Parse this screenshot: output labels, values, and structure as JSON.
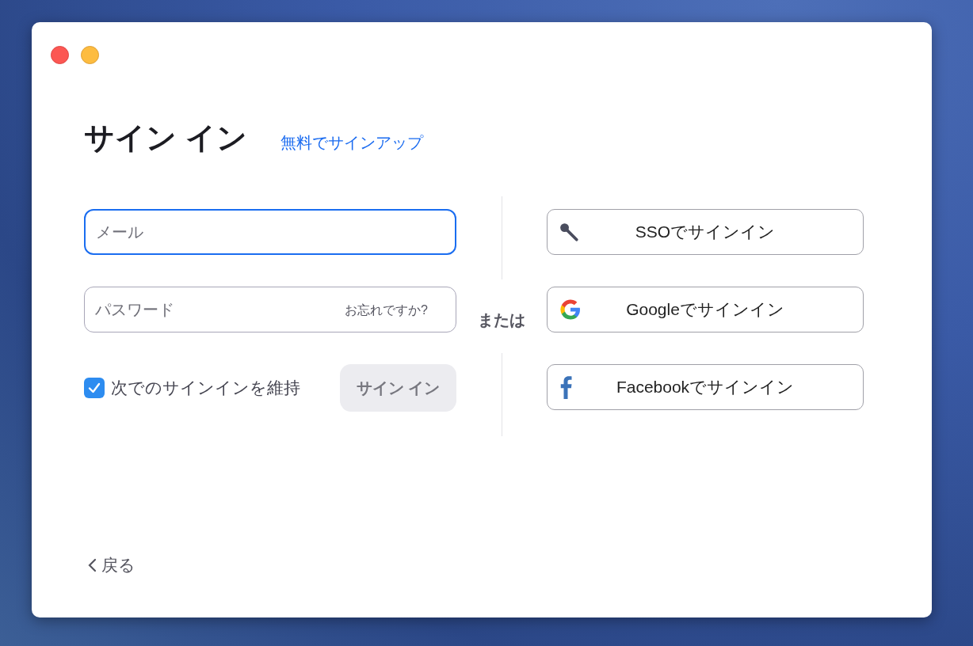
{
  "title": "サイン イン",
  "signup_link": "無料でサインアップ",
  "email_field": {
    "placeholder": "メール",
    "focused": true
  },
  "password_field": {
    "placeholder": "パスワード",
    "focused": false,
    "forgot_link": "お忘れですか?"
  },
  "keep_signed_in": {
    "label": "次でのサインインを維持",
    "checked": true
  },
  "sign_in_button": {
    "label": "サイン イン",
    "disabled": true
  },
  "separator": "または",
  "providers": [
    {
      "kind": "sso",
      "label": "SSOでサインイン"
    },
    {
      "kind": "google",
      "label": "Googleでサインイン"
    },
    {
      "kind": "facebook",
      "label": "Facebookでサインイン"
    }
  ],
  "back_link": "戻る"
}
